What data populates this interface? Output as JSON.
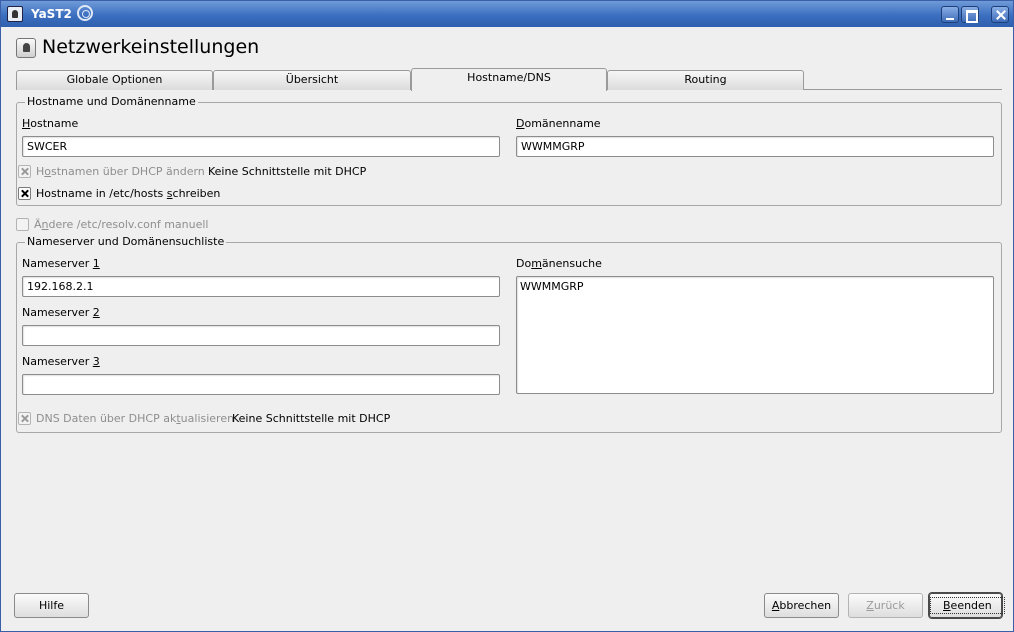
{
  "window": {
    "title": "YaST2"
  },
  "header": {
    "title": "Netzwerkeinstellungen"
  },
  "tabs": [
    {
      "label": "Globale Optionen"
    },
    {
      "label": "Übersicht"
    },
    {
      "label": "Hostname/DNS"
    },
    {
      "label": "Routing"
    }
  ],
  "hostname_group": {
    "title": "Hostname und Domänenname",
    "hostname_label_u": "H",
    "hostname_label_rest": "ostname",
    "hostname_value": "SWCER",
    "domain_label_u": "D",
    "domain_label_rest": "omänenname",
    "domain_value": "WWMMGRP",
    "dhcp_change_label": {
      "pre": "H",
      "u": "o",
      "post": "stnamen über DHCP ändern"
    },
    "dhcp_note": "Keine Schnittstelle mit DHCP",
    "write_hosts_label": {
      "pre": "Hostname in /etc/hosts ",
      "u": "s",
      "post": "chreiben"
    }
  },
  "resolv_manual": {
    "pre": "Ä",
    "u": "n",
    "post": "dere /etc/resolv.conf manuell"
  },
  "nameserver_group": {
    "title": "Nameserver und Domänensuchliste",
    "ns1_label_pre": "Nameserver ",
    "ns1_label_u": "1",
    "ns1_value": "192.168.2.1",
    "ns2_label_pre": "Nameserver ",
    "ns2_label_u": "2",
    "ns2_value": "",
    "ns3_label_pre": "Nameserver ",
    "ns3_label_u": "3",
    "ns3_value": "",
    "search_label": {
      "pre": "Do",
      "u": "m",
      "post": "änensuche"
    },
    "search_value": "WWMMGRP",
    "dns_dhcp_label": {
      "pre": "DNS Daten über DHCP ak",
      "u": "t",
      "post": "ualisieren"
    },
    "dns_dhcp_note": "Keine Schnittstelle mit DHCP"
  },
  "buttons": {
    "help": "Hilfe",
    "cancel_u": "A",
    "cancel_rest": "bbrechen",
    "back_u": "Z",
    "back_rest": "urück",
    "finish_u": "B",
    "finish_rest": "eenden"
  }
}
